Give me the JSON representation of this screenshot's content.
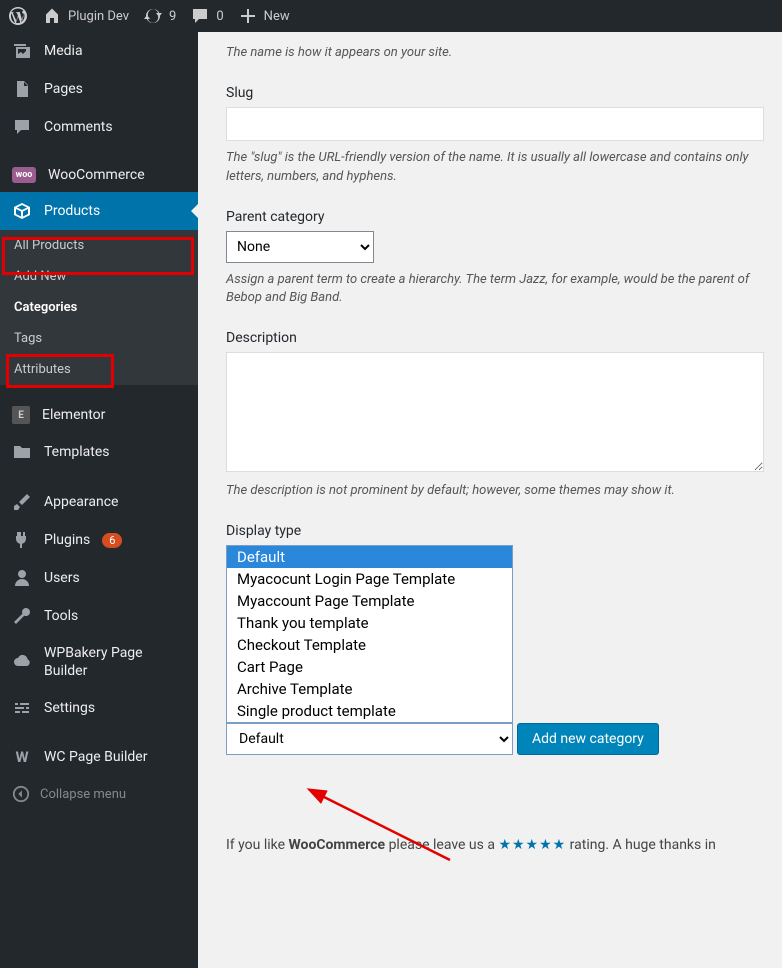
{
  "adminbar": {
    "site": "Plugin Dev",
    "updates": "9",
    "comments": "0",
    "new": "New"
  },
  "sidebar": {
    "media": "Media",
    "pages": "Pages",
    "comments": "Comments",
    "woocommerce": "WooCommerce",
    "products": "Products",
    "elementor": "Elementor",
    "templates": "Templates",
    "appearance": "Appearance",
    "plugins": "Plugins",
    "plugins_badge": "6",
    "users": "Users",
    "tools": "Tools",
    "wpbakery": "WPBakery Page Builder",
    "settings": "Settings",
    "wcpb": "WC Page Builder",
    "collapse": "Collapse menu",
    "sub": {
      "all": "All Products",
      "addnew": "Add New",
      "categories": "Categories",
      "tags": "Tags",
      "attributes": "Attributes"
    }
  },
  "form": {
    "name_help": "The name is how it appears on your site.",
    "slug_label": "Slug",
    "slug_help": "The \"slug\" is the URL-friendly version of the name. It is usually all lowercase and contains only letters, numbers, and hyphens.",
    "parent_label": "Parent category",
    "parent_value": "None",
    "parent_help": "Assign a parent term to create a hierarchy. The term Jazz, for example, would be the parent of Bebop and Big Band.",
    "desc_label": "Description",
    "desc_help": "The description is not prominent by default; however, some themes may show it.",
    "display_label": "Display type",
    "display_options": [
      "Default",
      "Myacocunt Login Page Template",
      "Myaccount Page Template",
      "Thank you template",
      "Checkout Template",
      "Cart Page",
      "Archive Template",
      "Single product template"
    ],
    "display_selected": "Default",
    "submit": "Add new category"
  },
  "footer": {
    "pre": "If you like ",
    "brand": "WooCommerce",
    "mid": " please leave us a ",
    "stars": "★★★★★",
    "post": " rating. A huge thanks in"
  }
}
